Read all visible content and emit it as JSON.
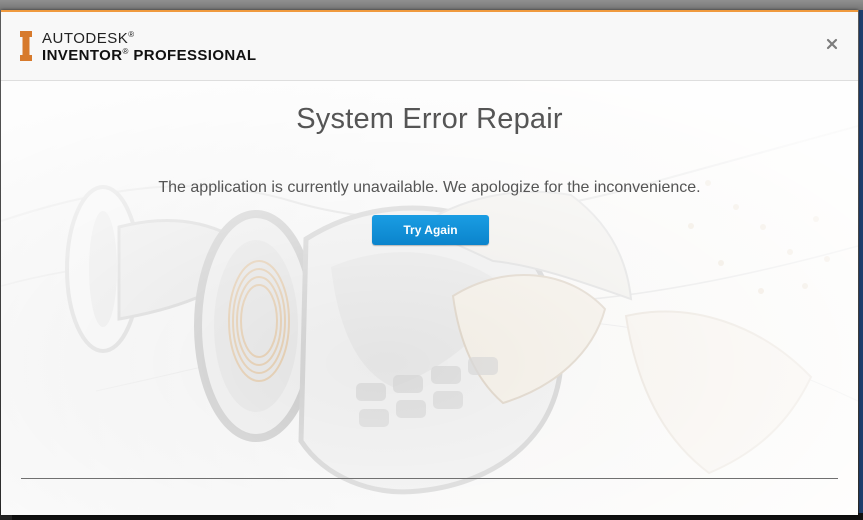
{
  "window": {
    "brand_top": "AUTODESK",
    "brand_bottom": "INVENTOR",
    "brand_bottom_suffix": "PROFESSIONAL",
    "registered_mark": "®",
    "close_glyph": "×",
    "accent_color": "#f09a3e"
  },
  "dialog": {
    "title": "System Error Repair",
    "message": "The application is currently unavailable. We apologize for the inconvenience.",
    "button_label": "Try Again",
    "button_color": "#0f8fd8"
  },
  "icons": {
    "logo": "inventor-i-logo-icon",
    "close": "close-icon"
  }
}
